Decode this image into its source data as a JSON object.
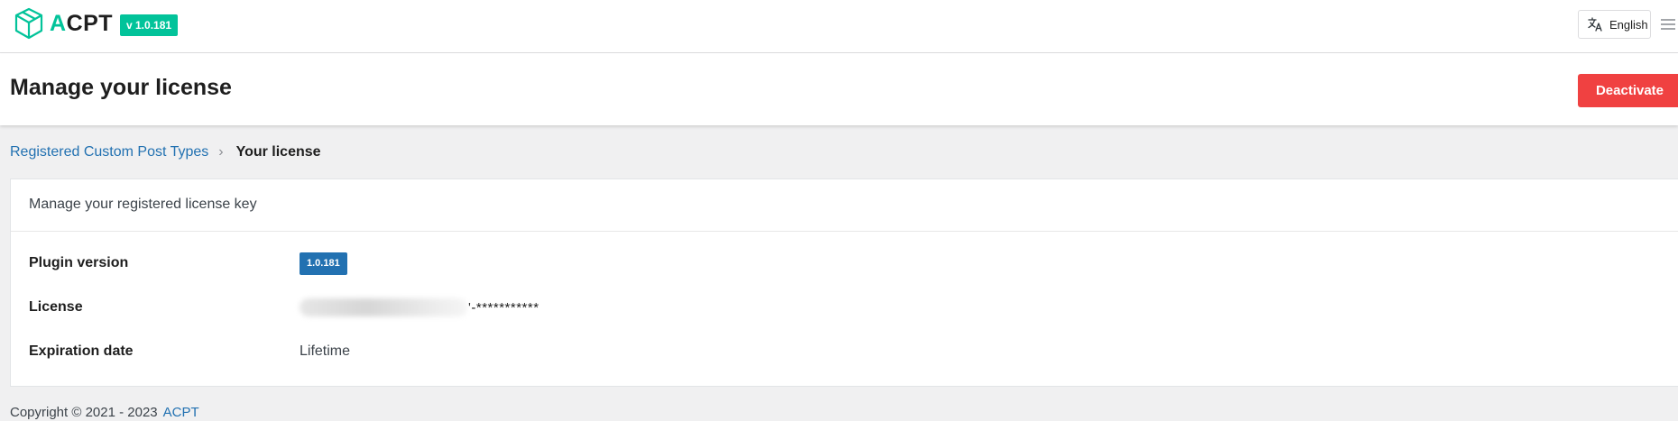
{
  "topbar": {
    "brand_first_letter": "A",
    "brand_rest": "CPT",
    "version_badge": "v 1.0.181",
    "language_label": "English",
    "icons": [
      "cube-logo-icon",
      "translate-icon",
      "hamburger-menu-icon"
    ],
    "accent_color": "#02c39a"
  },
  "header": {
    "title": "Manage your license",
    "deactivate_label": "Deactivate",
    "deactivate_color": "#f04141"
  },
  "breadcrumb": {
    "link_label": "Registered Custom Post Types",
    "separator": "›",
    "current_label": "Your license"
  },
  "card": {
    "description": "Manage your registered license key",
    "rows": [
      {
        "label": "Plugin version",
        "value": "1.0.181"
      },
      {
        "label": "License",
        "value": "'-***********"
      },
      {
        "label": "Expiration date",
        "value": "Lifetime"
      }
    ]
  },
  "footer": {
    "copyright": "Copyright © 2021 - 2023",
    "link_label": "ACPT"
  }
}
